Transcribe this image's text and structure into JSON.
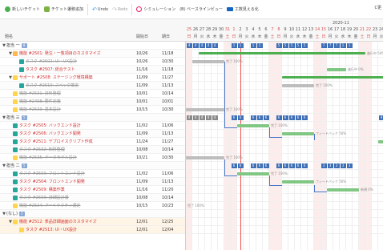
{
  "toolbar": {
    "new_ticket": "新しいチケット",
    "flow": "チケット遷移追加",
    "undo": "Undo",
    "redo": "Redo",
    "simulation": "シミュレーション",
    "baseline": "(B) ベースラインビュー",
    "critical": "工数見える化",
    "right_label": "C更"
  },
  "header": {
    "col_title": "題名",
    "col_start": "開始日",
    "col_due": "期日",
    "month": "2020-11",
    "days": [
      "25",
      "26",
      "27",
      "28",
      "29",
      "30",
      "31",
      "1",
      "2",
      "3",
      "4",
      "5",
      "6",
      "7",
      "8",
      "9",
      "10",
      "11",
      "12",
      "13",
      "14",
      "15",
      "16",
      "17",
      "18",
      "19",
      "20",
      "21",
      "22",
      "23",
      "24",
      "25",
      "26",
      "27"
    ],
    "dows": [
      "日",
      "月",
      "火",
      "水",
      "木",
      "金",
      "土",
      "日",
      "月",
      "火",
      "水",
      "木",
      "金",
      "土",
      "日",
      "月",
      "火",
      "水",
      "木",
      "金",
      "土",
      "日",
      "月",
      "火",
      "水",
      "木",
      "金",
      "土",
      "日",
      "月",
      "火",
      "水",
      "木",
      "金"
    ],
    "holiday_flags": [
      1,
      0,
      0,
      0,
      0,
      0,
      1,
      1,
      0,
      0,
      0,
      0,
      0,
      1,
      1,
      0,
      0,
      0,
      0,
      0,
      1,
      1,
      0,
      0,
      0,
      0,
      0,
      1,
      1,
      0,
      0,
      0,
      0,
      0
    ]
  },
  "rows": [
    {
      "indent": 0,
      "twisty": "▼",
      "icon": "",
      "title": "担当 一",
      "badge": "8",
      "kind": "grp",
      "start": "",
      "due": ""
    },
    {
      "indent": 1,
      "twisty": "▼",
      "icon": "bug",
      "title": "機能 #2501: 発注・一覧項目のカスタマイズ",
      "kind": "bug",
      "start": "10/26",
      "due": "11/18"
    },
    {
      "indent": 2,
      "twisty": "",
      "icon": "task",
      "title": "タスク #2502: UI・UX設計",
      "kind": "done",
      "start": "10/26",
      "due": "10/30"
    },
    {
      "indent": 2,
      "twisty": "",
      "icon": "task",
      "title": "タスク #2507: 総合テスト",
      "kind": "task",
      "start": "11/16",
      "due": "11/18"
    },
    {
      "indent": 1,
      "twisty": "▼",
      "icon": "sup",
      "title": "サポート #2508: ステージング環境構築",
      "kind": "sup",
      "start": "11/09",
      "due": "11/27"
    },
    {
      "indent": 2,
      "twisty": "",
      "icon": "task",
      "title": "タスク #2510: スペック策定",
      "kind": "done",
      "start": "11/09",
      "due": "11/13"
    },
    {
      "indent": 1,
      "twisty": "",
      "icon": "sup",
      "title": "機能 #2531: 資料整理",
      "kind": "done",
      "start": "10/01",
      "due": "10/14"
    },
    {
      "indent": 1,
      "twisty": "",
      "icon": "sup",
      "title": "機能 #2498: 要件定義",
      "kind": "done",
      "start": "10/01",
      "due": "10/01"
    },
    {
      "indent": 1,
      "twisty": "",
      "icon": "sup",
      "title": "機能 #2533: 基本設計",
      "kind": "done",
      "start": "10/15",
      "due": "10/30"
    },
    {
      "indent": 0,
      "twisty": "▼",
      "icon": "",
      "title": "担当 三",
      "badge": "5",
      "kind": "grp",
      "start": "",
      "due": ""
    },
    {
      "indent": 1,
      "twisty": "",
      "icon": "task",
      "title": "タスク #2505: バックエンド設計",
      "kind": "task",
      "start": "11/02",
      "due": "11/06"
    },
    {
      "indent": 1,
      "twisty": "",
      "icon": "task",
      "title": "タスク #2506: バックエンド開発",
      "kind": "task",
      "start": "11/09",
      "due": "11/13"
    },
    {
      "indent": 1,
      "twisty": "",
      "icon": "task",
      "title": "タスク #2511: デプロイスクリプト作成",
      "kind": "task",
      "start": "11/24",
      "due": "11/27"
    },
    {
      "indent": 1,
      "twisty": "",
      "icon": "task",
      "title": "タスク #2532: 知財整理",
      "kind": "done",
      "start": "10/08",
      "due": "10/14"
    },
    {
      "indent": 1,
      "twisty": "",
      "icon": "sup",
      "title": "機能 #2535: データモデル設計",
      "kind": "done",
      "start": "10/21",
      "due": "10/30"
    },
    {
      "indent": 0,
      "twisty": "▼",
      "icon": "",
      "title": "担当 二",
      "badge": "5",
      "kind": "grp",
      "start": "",
      "due": ""
    },
    {
      "indent": 1,
      "twisty": "",
      "icon": "task",
      "title": "タスク #2503: フロントエンド設計",
      "kind": "done",
      "start": "11/02",
      "due": "11/06"
    },
    {
      "indent": 1,
      "twisty": "",
      "icon": "task",
      "title": "タスク #2504: フロントエンド開発",
      "kind": "task",
      "start": "11/09",
      "due": "11/13"
    },
    {
      "indent": 1,
      "twisty": "",
      "icon": "task",
      "title": "タスク #2509: 構築作業",
      "kind": "task",
      "start": "11/16",
      "due": "11/20"
    },
    {
      "indent": 1,
      "twisty": "",
      "icon": "task",
      "title": "タスク #2503: 詳細設計書",
      "kind": "done",
      "start": "10/08",
      "due": "10/14"
    },
    {
      "indent": 1,
      "twisty": "",
      "icon": "sup",
      "title": "機能 #2534: アーキテクチャ選定",
      "kind": "done",
      "start": "10/15",
      "due": "10/23"
    },
    {
      "indent": 0,
      "twisty": "▼",
      "icon": "",
      "title": "(なし)",
      "badge": "2",
      "kind": "grp",
      "start": "",
      "due": ""
    },
    {
      "indent": 1,
      "twisty": "▼",
      "icon": "sup",
      "title": "機能 #2512: 表品詳細画面のカスタマイズ",
      "kind": "bug",
      "start": "12/01",
      "due": "12/25",
      "sel": true
    },
    {
      "indent": 2,
      "twisty": "",
      "icon": "sup",
      "title": "タスク #2513: UI・UX設計",
      "kind": "task",
      "start": "12/01",
      "due": "12/04",
      "sel": true
    }
  ],
  "gantt": {
    "bars": [
      {
        "row": 1,
        "col": 2,
        "len": 26,
        "type": "green",
        "label": "進行中 50%"
      },
      {
        "row": 2,
        "col": 1,
        "len": 5,
        "type": "gray",
        "label": "完了 100%"
      },
      {
        "row": 3,
        "col": 22,
        "len": 3,
        "type": "prog",
        "label": "進行中 0%"
      },
      {
        "row": 4,
        "col": 15,
        "len": 19,
        "type": "green",
        "label": ""
      },
      {
        "row": 5,
        "col": 15,
        "len": 5,
        "type": "gray",
        "label": "完了 100%"
      },
      {
        "row": 8,
        "col": 0,
        "len": 6,
        "type": "gray",
        "label": "完了 100%"
      },
      {
        "row": 10,
        "col": 8,
        "len": 5,
        "type": "prog",
        "label": "完了 100%"
      },
      {
        "row": 11,
        "col": 15,
        "len": 5,
        "type": "prog",
        "label": "フィードバック 50%"
      },
      {
        "row": 12,
        "col": 30,
        "len": 4,
        "type": "prog",
        "label": ""
      },
      {
        "row": 14,
        "col": 0,
        "len": 6,
        "type": "gray",
        "label": "完了 100%"
      },
      {
        "row": 16,
        "col": 8,
        "len": 5,
        "type": "prog",
        "label": "完了 100%"
      },
      {
        "row": 17,
        "col": 15,
        "len": 5,
        "type": "prog",
        "label": "フィードバック 50%"
      },
      {
        "row": 18,
        "col": 22,
        "len": 5,
        "type": "prog",
        "label": "新規 0%"
      },
      {
        "row": 20,
        "col": 0,
        "len": 0,
        "type": "gray",
        "label": "完了 100%"
      }
    ],
    "effort_rows": [
      {
        "row": 0,
        "cells": [
          [
            0,
            "4"
          ],
          [
            1,
            "4"
          ],
          [
            2,
            "4"
          ],
          [
            3,
            "4"
          ],
          [
            4,
            "4"
          ],
          [
            7,
            "1"
          ],
          [
            8,
            "1"
          ],
          [
            10,
            "1"
          ],
          [
            11,
            "1"
          ],
          [
            14,
            "5"
          ],
          [
            15,
            "5"
          ],
          [
            16,
            "5"
          ],
          [
            17,
            "5"
          ],
          [
            18,
            "5"
          ],
          [
            21,
            "7"
          ],
          [
            22,
            "7"
          ],
          [
            23,
            "7"
          ],
          [
            24,
            "1"
          ],
          [
            25,
            "1"
          ]
        ]
      },
      {
        "row": 9,
        "cells": [
          [
            0,
            "4",
            "g"
          ],
          [
            1,
            "4",
            "g"
          ],
          [
            2,
            "4",
            "g"
          ],
          [
            3,
            "4",
            "g"
          ],
          [
            4,
            "4",
            "g"
          ],
          [
            7,
            "6"
          ],
          [
            8,
            "6"
          ],
          [
            10,
            "6"
          ],
          [
            11,
            "6"
          ],
          [
            12,
            "6"
          ],
          [
            14,
            "6"
          ],
          [
            15,
            "6"
          ],
          [
            16,
            "6"
          ],
          [
            17,
            "6"
          ],
          [
            18,
            "6"
          ],
          [
            30,
            "4"
          ],
          [
            31,
            "4"
          ],
          [
            32,
            "4"
          ],
          [
            33,
            "4"
          ]
        ]
      },
      {
        "row": 15,
        "cells": [
          [
            7,
            "6"
          ],
          [
            8,
            "6"
          ],
          [
            10,
            "6"
          ],
          [
            11,
            "6"
          ],
          [
            12,
            "6"
          ],
          [
            14,
            "6"
          ],
          [
            15,
            "6"
          ],
          [
            16,
            "6"
          ],
          [
            17,
            "6"
          ],
          [
            18,
            "6"
          ],
          [
            21,
            "3"
          ],
          [
            22,
            "3"
          ],
          [
            23,
            "3"
          ],
          [
            24,
            "3"
          ],
          [
            25,
            "3"
          ]
        ]
      }
    ]
  }
}
